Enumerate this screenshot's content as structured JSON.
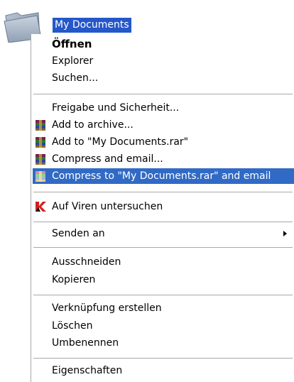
{
  "desktop": {
    "selected_folder_label": "My Documents"
  },
  "context_menu": {
    "items": [
      {
        "label": "Öffnen",
        "icon": "none"
      },
      {
        "label": "Explorer",
        "icon": "none"
      },
      {
        "label": "Suchen...",
        "icon": "none"
      },
      {
        "label": "Freigabe und Sicherheit...",
        "icon": "none"
      },
      {
        "label": "Add to archive...",
        "icon": "winrar-icon"
      },
      {
        "label": "Add to \"My Documents.rar\"",
        "icon": "winrar-icon"
      },
      {
        "label": "Compress and email...",
        "icon": "winrar-icon"
      },
      {
        "label": "Compress to \"My Documents.rar\" and email",
        "icon": "winrar-icon",
        "state": "highlighted"
      },
      {
        "label": "Auf Viren untersuchen",
        "icon": "kaspersky-icon"
      },
      {
        "label": "Senden an",
        "icon": "none",
        "submenu": true
      },
      {
        "label": "Ausschneiden",
        "icon": "none"
      },
      {
        "label": "Kopieren",
        "icon": "none"
      },
      {
        "label": "Verknüpfung erstellen",
        "icon": "none"
      },
      {
        "label": "Löschen",
        "icon": "none"
      },
      {
        "label": "Umbenennen",
        "icon": "none"
      },
      {
        "label": "Eigenschaften",
        "icon": "none"
      }
    ]
  },
  "colors": {
    "selection": "#2457c9",
    "highlight": "#316ac5",
    "separator": "#a8a8a8"
  }
}
